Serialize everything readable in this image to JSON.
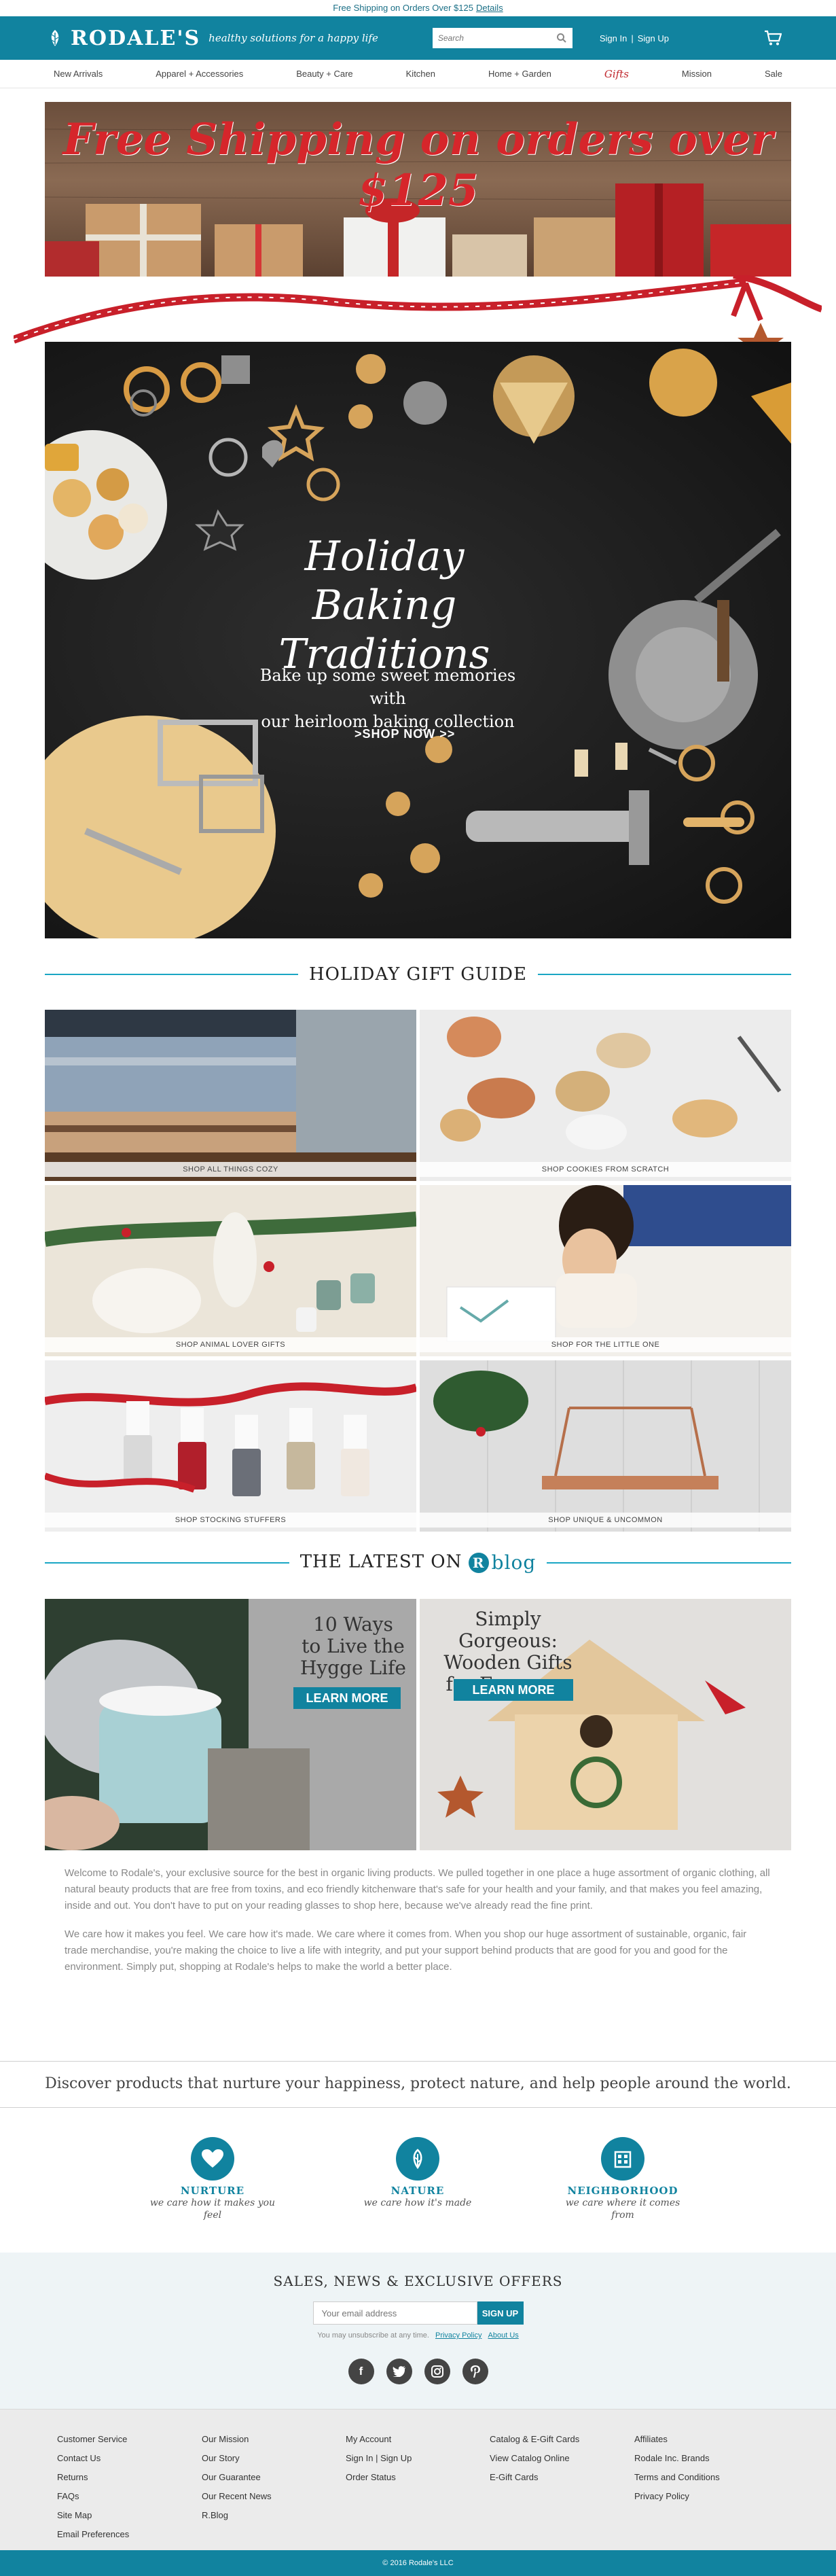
{
  "promo": {
    "text": "Free Shipping on Orders Over $125",
    "link": "Details"
  },
  "header": {
    "brand": "RODALE'S",
    "tagline": "healthy solutions for a happy life",
    "search_placeholder": "Search",
    "sign_in": "Sign In",
    "separator": "|",
    "sign_up": "Sign Up",
    "brand_color": "#11839f"
  },
  "nav": [
    "New Arrivals",
    "Apparel + Accessories",
    "Beauty + Care",
    "Kitchen",
    "Home + Garden",
    "Gifts",
    "Mission",
    "Sale"
  ],
  "shipping_banner": {
    "headline": "Free Shipping on orders over $125"
  },
  "hero": {
    "title_line1": "Holiday",
    "title_line2": "Baking Traditions",
    "subtitle_line1": "Bake up some sweet memories with",
    "subtitle_line2": "our heirloom baking collection",
    "cta": ">SHOP NOW >>"
  },
  "gift_guide": {
    "title": "HOLIDAY GIFT GUIDE",
    "tiles": [
      {
        "label": "SHOP ALL THINGS COZY"
      },
      {
        "label": "SHOP COOKIES FROM SCRATCH"
      },
      {
        "label": "SHOP ANIMAL LOVER GIFTS"
      },
      {
        "label": "SHOP FOR THE LITTLE ONE"
      },
      {
        "label": "SHOP STOCKING STUFFERS"
      },
      {
        "label": "SHOP UNIQUE & UNCOMMON"
      }
    ]
  },
  "blog": {
    "title": "THE LATEST ON",
    "logo_letter": "R",
    "logo_word": "blog",
    "cards": [
      {
        "line1": "10 Ways",
        "line2": "to Live the",
        "line3": "Hygge Life",
        "cta": "LEARN MORE"
      },
      {
        "line1": "Simply Gorgeous:",
        "line2": "Wooden Gifts",
        "line3": "for Everyone",
        "cta": "LEARN MORE"
      }
    ]
  },
  "intro": {
    "p1": "Welcome to Rodale's, your exclusive source for the best in organic living products. We pulled together in one place a huge assortment of organic clothing, all natural beauty products that are free from toxins, and eco friendly kitchenware that's safe for your health and your family, and that makes you feel amazing, inside and out. You don't have to put on your reading glasses to shop here, because we've already read the fine print.",
    "p2": "We care how it makes you feel. We care how it's made. We care where it comes from. When you shop our huge assortment of sustainable, organic, fair trade merchandise, you're making the choice to live a life with integrity, and put your support behind products that are good for you and good for the environment. Simply put, shopping at Rodale's helps to make the world a better place."
  },
  "tagline_banner": "Discover products that nurture your happiness, protect nature, and help people around the world.",
  "values": [
    {
      "name": "NURTURE",
      "desc_line1": "we care how it makes you",
      "desc_line2": "feel",
      "icon": "heart-icon"
    },
    {
      "name": "NATURE",
      "desc_line1": "we care how it's made",
      "desc_line2": "",
      "icon": "leaf-icon"
    },
    {
      "name": "NEIGHBORHOOD",
      "desc_line1": "we care where it comes",
      "desc_line2": "from",
      "icon": "building-icon"
    }
  ],
  "signup": {
    "title": "SALES, NEWS & EXCLUSIVE OFFERS",
    "placeholder": "Your email address",
    "button": "SIGN UP",
    "fine": "You may unsubscribe at any time.",
    "privacy": "Privacy Policy",
    "about": "About Us"
  },
  "social": [
    "f",
    "t",
    "ig",
    "p"
  ],
  "footer": {
    "col1": [
      "Customer Service",
      "Contact Us",
      "Returns",
      "FAQs",
      "Site Map",
      "Email Preferences"
    ],
    "col2": [
      "Our Mission",
      "Our Story",
      "Our Guarantee",
      "Our Recent News",
      "R.Blog"
    ],
    "col3": [
      "My Account",
      "Sign In | Sign Up",
      "Order Status"
    ],
    "col4": [
      "Catalog & E-Gift Cards",
      "View Catalog Online",
      "E-Gift Cards"
    ],
    "col5": [
      "Affiliates",
      "Rodale Inc. Brands",
      "Terms and Conditions",
      "Privacy Policy"
    ],
    "copyright": "© 2016 Rodale's LLC"
  }
}
